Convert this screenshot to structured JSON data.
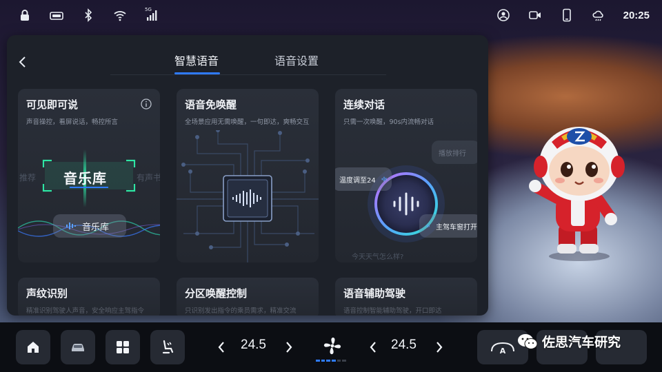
{
  "status_bar": {
    "icons_left": [
      "lock-icon",
      "camera-record-icon",
      "bluetooth-icon",
      "wifi-icon",
      "5g-signal-icon"
    ],
    "signal_label": "5G",
    "icons_right": [
      "user-profile-icon",
      "video-camera-icon",
      "phone-icon",
      "weather-icon"
    ],
    "time": "20:25"
  },
  "panel": {
    "tabs": [
      {
        "label": "智慧语音",
        "active": true
      },
      {
        "label": "语音设置",
        "active": false
      }
    ],
    "cards": [
      {
        "title": "可见即可说",
        "subtitle": "声音操控，看屏说话，畅控所言",
        "art": {
          "big_label": "音乐库",
          "faint_left": "推荐",
          "faint_right": "有声书",
          "chip": "音乐库"
        }
      },
      {
        "title": "语音免唤醒",
        "subtitle": "全场景应用无需唤醒，一句即达，爽畅交互"
      },
      {
        "title": "连续对话",
        "subtitle": "只需一次唤醒，90s内流畅对话",
        "art": {
          "chip_a": "温度调至24",
          "chip_b": "主驾车窗打开",
          "chip_c": "播放排行",
          "faint_bottom": "今天天气怎么样?"
        }
      },
      {
        "title": "声纹识别",
        "subtitle": "精准识别驾驶人声音，安全响应主驾指令"
      },
      {
        "title": "分区唤醒控制",
        "subtitle": "只识别发出指令的乘员需求，精准交流"
      },
      {
        "title": "语音辅助驾驶",
        "subtitle": "语音控制智能辅助驾驶，开口即达"
      }
    ]
  },
  "dock": {
    "left_temp": "24.5",
    "right_temp": "24.5",
    "ac_label": "A",
    "fan_level": 4,
    "fan_level_max": 6
  },
  "watermark": {
    "text": "佐思汽车研究"
  },
  "colors": {
    "accent": "#2f7bff",
    "scan_green": "#2ee6a4",
    "panel_bg": "#1d2129",
    "card_bg": "#262a33"
  }
}
